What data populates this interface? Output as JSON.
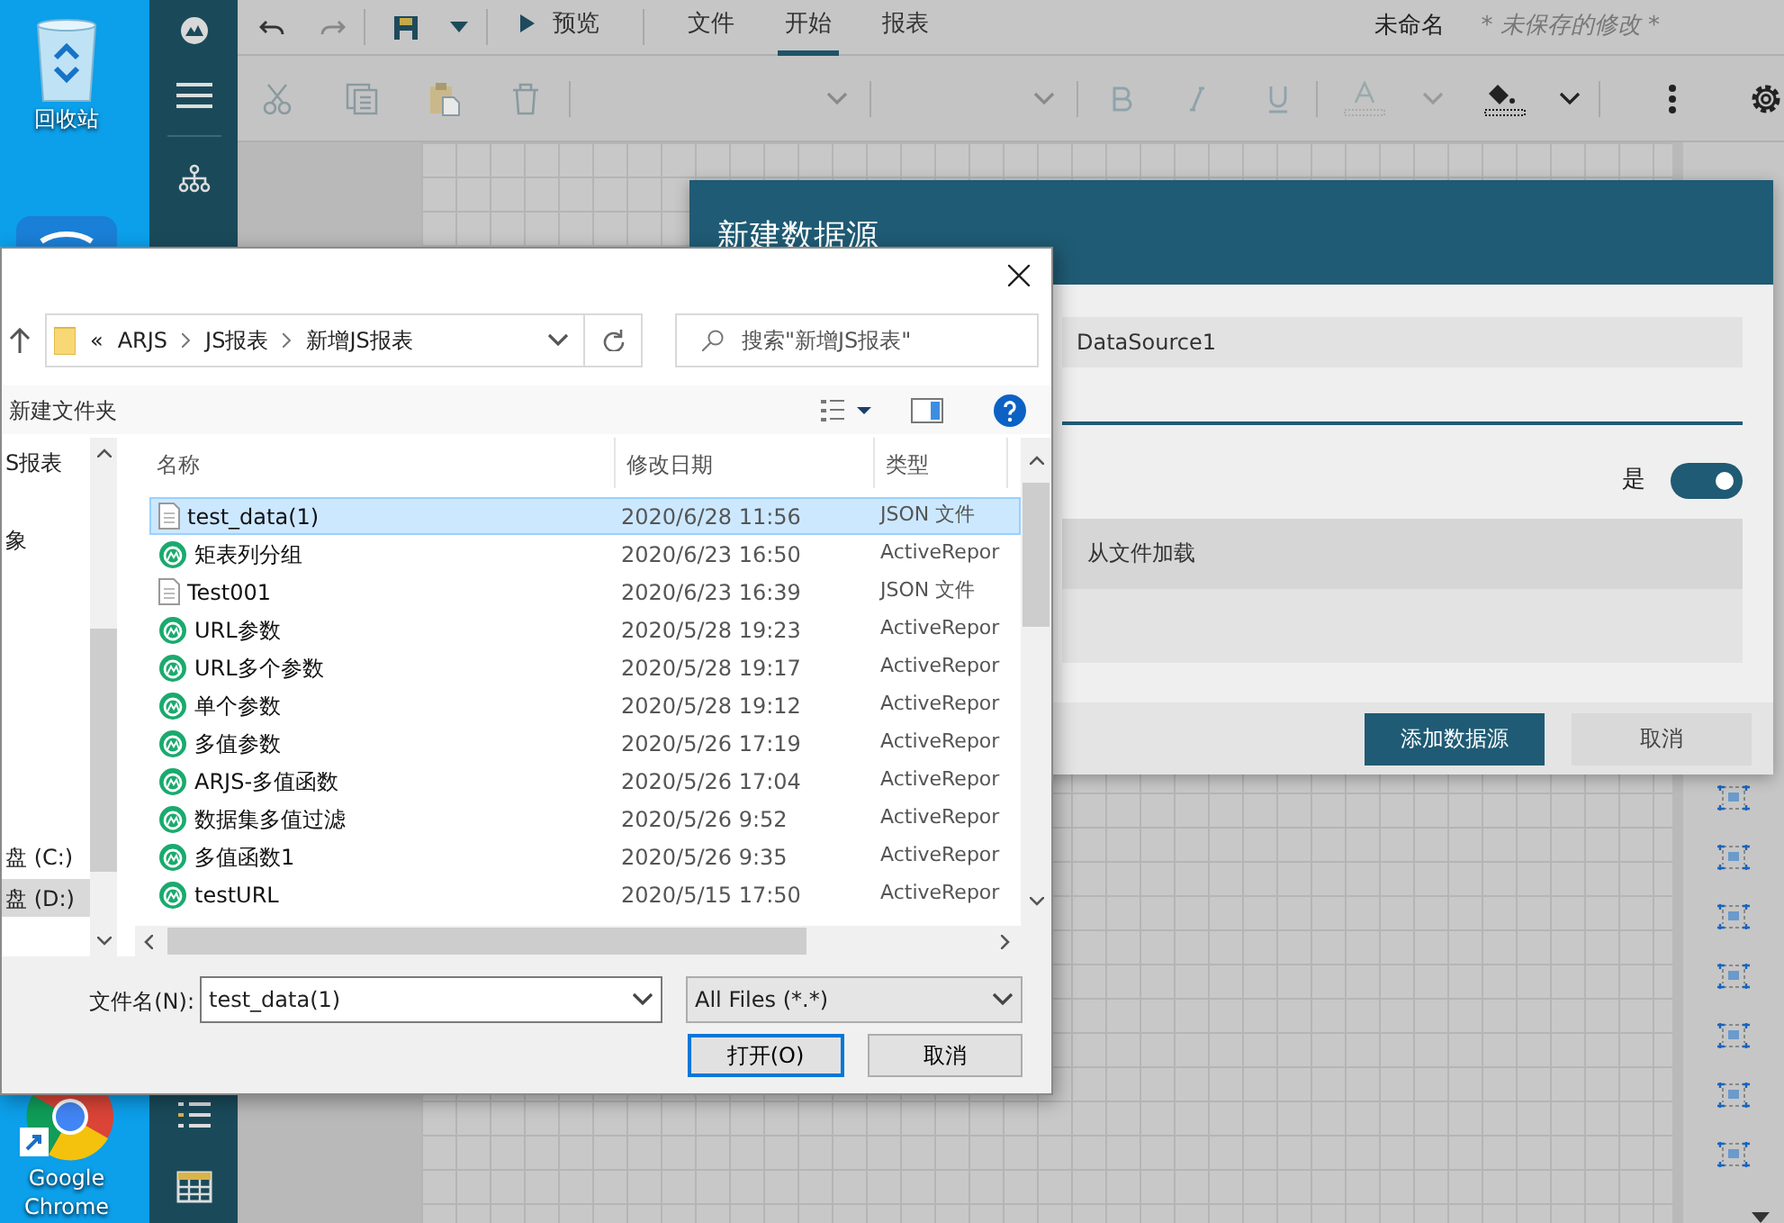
{
  "desktop": {
    "icons": [
      {
        "kind": "recycle-bin",
        "label": "回收站"
      },
      {
        "kind": "network"
      },
      {
        "kind": "chrome",
        "label": "Google Chrome"
      }
    ]
  },
  "app": {
    "quick_bar": {
      "preview": "预览",
      "menu_tabs": [
        {
          "label": "文件",
          "selected": false
        },
        {
          "label": "开始",
          "selected": true
        },
        {
          "label": "报表",
          "selected": false
        }
      ],
      "document_name": "未命名",
      "unsaved_note": "* 未保存的修改 *"
    }
  },
  "datasource_dialog": {
    "title": "新建数据源",
    "name_value": "DataSource1",
    "toggle_label": "是",
    "toggle_on": true,
    "source_option": "从文件加载",
    "buttons": [
      {
        "label": "添加数据源",
        "kind": "primary"
      },
      {
        "label": "取消",
        "kind": "secondary"
      }
    ]
  },
  "file_dialog": {
    "path_prefix": "«",
    "path": [
      "ARJS",
      "JS报表",
      "新增JS报表"
    ],
    "search_placeholder": "搜索\"新增JS报表\"",
    "new_folder": "新建文件夹",
    "nav_items": [
      {
        "label": "S报表",
        "selected": false
      },
      {
        "label": "象",
        "selected": false
      },
      {
        "label": "盘 (C:)",
        "selected": false
      },
      {
        "label": "盘 (D:)",
        "selected": true
      }
    ],
    "columns": [
      "名称",
      "修改日期",
      "类型"
    ],
    "rows": [
      {
        "name": "test_data(1)",
        "date": "2020/6/28 11:56",
        "type": "JSON 文件",
        "kind": "json",
        "selected": true
      },
      {
        "name": "矩表列分组",
        "date": "2020/6/23 16:50",
        "type": "ActiveRepor",
        "kind": "report",
        "selected": false
      },
      {
        "name": "Test001",
        "date": "2020/6/23 16:39",
        "type": "JSON 文件",
        "kind": "json",
        "selected": false
      },
      {
        "name": "URL参数",
        "date": "2020/5/28 19:23",
        "type": "ActiveRepor",
        "kind": "report",
        "selected": false
      },
      {
        "name": "URL多个参数",
        "date": "2020/5/28 19:17",
        "type": "ActiveRepor",
        "kind": "report",
        "selected": false
      },
      {
        "name": "单个参数",
        "date": "2020/5/28 19:12",
        "type": "ActiveRepor",
        "kind": "report",
        "selected": false
      },
      {
        "name": "多值参数",
        "date": "2020/5/26 17:19",
        "type": "ActiveRepor",
        "kind": "report",
        "selected": false
      },
      {
        "name": "ARJS-多值函数",
        "date": "2020/5/26 17:04",
        "type": "ActiveRepor",
        "kind": "report",
        "selected": false
      },
      {
        "name": "数据集多值过滤",
        "date": "2020/5/26 9:52",
        "type": "ActiveRepor",
        "kind": "report",
        "selected": false
      },
      {
        "name": "多值函数1",
        "date": "2020/5/26 9:35",
        "type": "ActiveRepor",
        "kind": "report",
        "selected": false
      },
      {
        "name": "testURL",
        "date": "2020/5/15 17:50",
        "type": "ActiveRepor",
        "kind": "report",
        "selected": false
      }
    ],
    "filename_label": "文件名(N):",
    "filename_value": "test_data(1)",
    "filter": "All Files (*.*)",
    "buttons": [
      {
        "label": "打开(O)",
        "kind": "default"
      },
      {
        "label": "取消",
        "kind": "normal"
      }
    ]
  }
}
